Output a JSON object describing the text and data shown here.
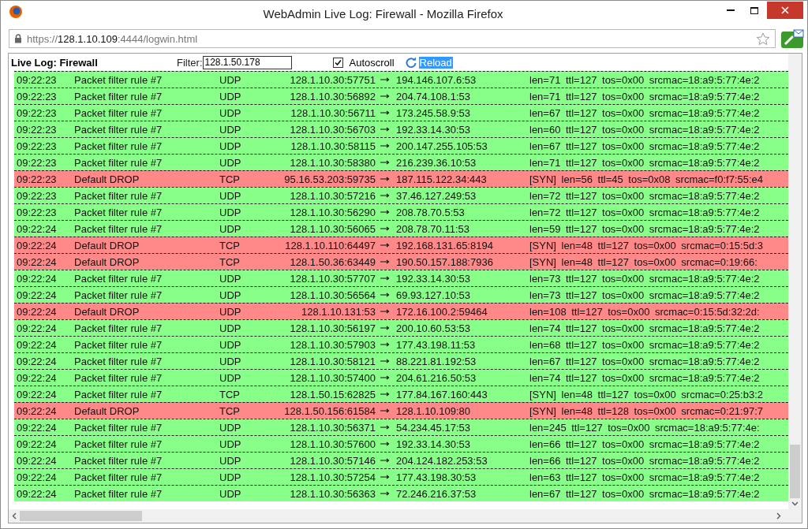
{
  "window": {
    "title": "WebAdmin Live Log: Firewall - Mozilla Firefox"
  },
  "address_bar": {
    "scheme": "https://",
    "host": "128.1.10.109",
    "rest": ":4444/logwin.html"
  },
  "toolbar": {
    "title": "Live Log: Firewall",
    "filter_label": "Filter:",
    "filter_value": "128.1.50.178",
    "autoscroll": {
      "label": "Autoscroll",
      "checked": true
    },
    "reload": {
      "label": "Reload",
      "selected": true
    }
  },
  "rows": [
    {
      "kind": "pass",
      "time": "09:22:23",
      "rule": "Packet filter rule #7",
      "proto": "UDP",
      "src": "128.1.10.30:57751",
      "dst": "194.146.107.6:53",
      "info": "len=71 ttl=127 tos=0x00 srcmac=18:a9:5:77:4e:2"
    },
    {
      "kind": "pass",
      "time": "09:22:23",
      "rule": "Packet filter rule #7",
      "proto": "UDP",
      "src": "128.1.10.30:56892",
      "dst": "204.74.108.1:53",
      "info": "len=71 ttl=127 tos=0x00 srcmac=18:a9:5:77:4e:2"
    },
    {
      "kind": "pass",
      "time": "09:22:23",
      "rule": "Packet filter rule #7",
      "proto": "UDP",
      "src": "128.1.10.30:56711",
      "dst": "173.245.58.9:53",
      "info": "len=67 ttl=127 tos=0x00 srcmac=18:a9:5:77:4e:2"
    },
    {
      "kind": "pass",
      "time": "09:22:23",
      "rule": "Packet filter rule #7",
      "proto": "UDP",
      "src": "128.1.10.30:56703",
      "dst": "192.33.14.30:53",
      "info": "len=60 ttl=127 tos=0x00 srcmac=18:a9:5:77:4e:2"
    },
    {
      "kind": "pass",
      "time": "09:22:23",
      "rule": "Packet filter rule #7",
      "proto": "UDP",
      "src": "128.1.10.30:58115",
      "dst": "200.147.255.105:53",
      "info": "len=67 ttl=127 tos=0x00 srcmac=18:a9:5:77:4e:2"
    },
    {
      "kind": "pass",
      "time": "09:22:23",
      "rule": "Packet filter rule #7",
      "proto": "UDP",
      "src": "128.1.10.30:58380",
      "dst": "216.239.36.10:53",
      "info": "len=71 ttl=127 tos=0x00 srcmac=18:a9:5:77:4e:2"
    },
    {
      "kind": "drop",
      "time": "09:22:23",
      "rule": "Default DROP",
      "proto": "TCP",
      "src": "95.16.53.203:59735",
      "dst": "187.115.122.34:443",
      "info": "[SYN] len=56 ttl=45 tos=0x08 srcmac=f0:f7:55:e4"
    },
    {
      "kind": "pass",
      "time": "09:22:23",
      "rule": "Packet filter rule #7",
      "proto": "UDP",
      "src": "128.1.10.30:57216",
      "dst": "37.46.127.249:53",
      "info": "len=72 ttl=127 tos=0x00 srcmac=18:a9:5:77:4e:2"
    },
    {
      "kind": "pass",
      "time": "09:22:23",
      "rule": "Packet filter rule #7",
      "proto": "UDP",
      "src": "128.1.10.30:56290",
      "dst": "208.78.70.5:53",
      "info": "len=72 ttl=127 tos=0x00 srcmac=18:a9:5:77:4e:2"
    },
    {
      "kind": "pass",
      "time": "09:22:24",
      "rule": "Packet filter rule #7",
      "proto": "UDP",
      "src": "128.1.10.30:56065",
      "dst": "208.78.70.11:53",
      "info": "len=59 ttl=127 tos=0x00 srcmac=18:a9:5:77:4e:2"
    },
    {
      "kind": "drop",
      "time": "09:22:24",
      "rule": "Default DROP",
      "proto": "TCP",
      "src": "128.1.10.110:64497",
      "dst": "192.168.131.65:8194",
      "info": "[SYN] len=48 ttl=127 tos=0x00 srcmac=0:15:5d:3"
    },
    {
      "kind": "drop",
      "time": "09:22:24",
      "rule": "Default DROP",
      "proto": "TCP",
      "src": "128.1.50.36:63449",
      "dst": "190.50.157.188:7936",
      "info": "[SYN] len=48 ttl=127 tos=0x00 srcmac=0:19:66:"
    },
    {
      "kind": "pass",
      "time": "09:22:24",
      "rule": "Packet filter rule #7",
      "proto": "UDP",
      "src": "128.1.10.30:57707",
      "dst": "192.33.14.30:53",
      "info": "len=73 ttl=127 tos=0x00 srcmac=18:a9:5:77:4e:2"
    },
    {
      "kind": "pass",
      "time": "09:22:24",
      "rule": "Packet filter rule #7",
      "proto": "UDP",
      "src": "128.1.10.30:56564",
      "dst": "69.93.127.10:53",
      "info": "len=73 ttl=127 tos=0x00 srcmac=18:a9:5:77:4e:2"
    },
    {
      "kind": "drop",
      "time": "09:22:24",
      "rule": "Default DROP",
      "proto": "UDP",
      "src": "128.1.10.131:53",
      "dst": "172.16.100.2:59464",
      "info": "len=108 ttl=127 tos=0x00 srcmac=0:15:5d:32:2d:"
    },
    {
      "kind": "pass",
      "time": "09:22:24",
      "rule": "Packet filter rule #7",
      "proto": "UDP",
      "src": "128.1.10.30:56197",
      "dst": "200.10.60.53:53",
      "info": "len=74 ttl=127 tos=0x00 srcmac=18:a9:5:77:4e:2"
    },
    {
      "kind": "pass",
      "time": "09:22:24",
      "rule": "Packet filter rule #7",
      "proto": "UDP",
      "src": "128.1.10.30:57903",
      "dst": "177.43.198.11:53",
      "info": "len=68 ttl=127 tos=0x00 srcmac=18:a9:5:77:4e:2"
    },
    {
      "kind": "pass",
      "time": "09:22:24",
      "rule": "Packet filter rule #7",
      "proto": "UDP",
      "src": "128.1.10.30:58121",
      "dst": "88.221.81.192:53",
      "info": "len=67 ttl=127 tos=0x00 srcmac=18:a9:5:77:4e:2"
    },
    {
      "kind": "pass",
      "time": "09:22:24",
      "rule": "Packet filter rule #7",
      "proto": "UDP",
      "src": "128.1.10.30:57400",
      "dst": "204.61.216.50:53",
      "info": "len=74 ttl=127 tos=0x00 srcmac=18:a9:5:77:4e:2"
    },
    {
      "kind": "pass",
      "time": "09:22:24",
      "rule": "Packet filter rule #7",
      "proto": "TCP",
      "src": "128.1.50.15:62825",
      "dst": "177.84.167.160:443",
      "info": "[SYN] len=48 ttl=127 tos=0x00 srcmac=0:25:b3:2"
    },
    {
      "kind": "drop",
      "time": "09:22:24",
      "rule": "Default DROP",
      "proto": "TCP",
      "src": "128.1.50.156:61584",
      "dst": "128.1.10.109:80",
      "info": "[SYN] len=48 ttl=128 tos=0x00 srcmac=0:21:97:7"
    },
    {
      "kind": "pass",
      "time": "09:22:24",
      "rule": "Packet filter rule #7",
      "proto": "UDP",
      "src": "128.1.10.30:56371",
      "dst": "54.234.45.17:53",
      "info": "len=245 ttl=127 tos=0x00 srcmac=18:a9:5:77:4e:"
    },
    {
      "kind": "pass",
      "time": "09:22:24",
      "rule": "Packet filter rule #7",
      "proto": "UDP",
      "src": "128.1.10.30:57600",
      "dst": "192.33.14.30:53",
      "info": "len=66 ttl=127 tos=0x00 srcmac=18:a9:5:77:4e:2"
    },
    {
      "kind": "pass",
      "time": "09:22:24",
      "rule": "Packet filter rule #7",
      "proto": "UDP",
      "src": "128.1.10.30:57146",
      "dst": "204.124.182.253:53",
      "info": "len=66 ttl=127 tos=0x00 srcmac=18:a9:5:77:4e:2"
    },
    {
      "kind": "pass",
      "time": "09:22:24",
      "rule": "Packet filter rule #7",
      "proto": "UDP",
      "src": "128.1.10.30:57254",
      "dst": "177.43.198.30:53",
      "info": "len=63 ttl=127 tos=0x00 srcmac=18:a9:5:77:4e:2"
    },
    {
      "kind": "pass",
      "time": "09:22:24",
      "rule": "Packet filter rule #7",
      "proto": "UDP",
      "src": "128.1.10.30:56363",
      "dst": "72.246.216.37:53",
      "info": "len=67 ttl=127 tos=0x00 srcmac=18:a9:5:77:4e:2"
    }
  ]
}
